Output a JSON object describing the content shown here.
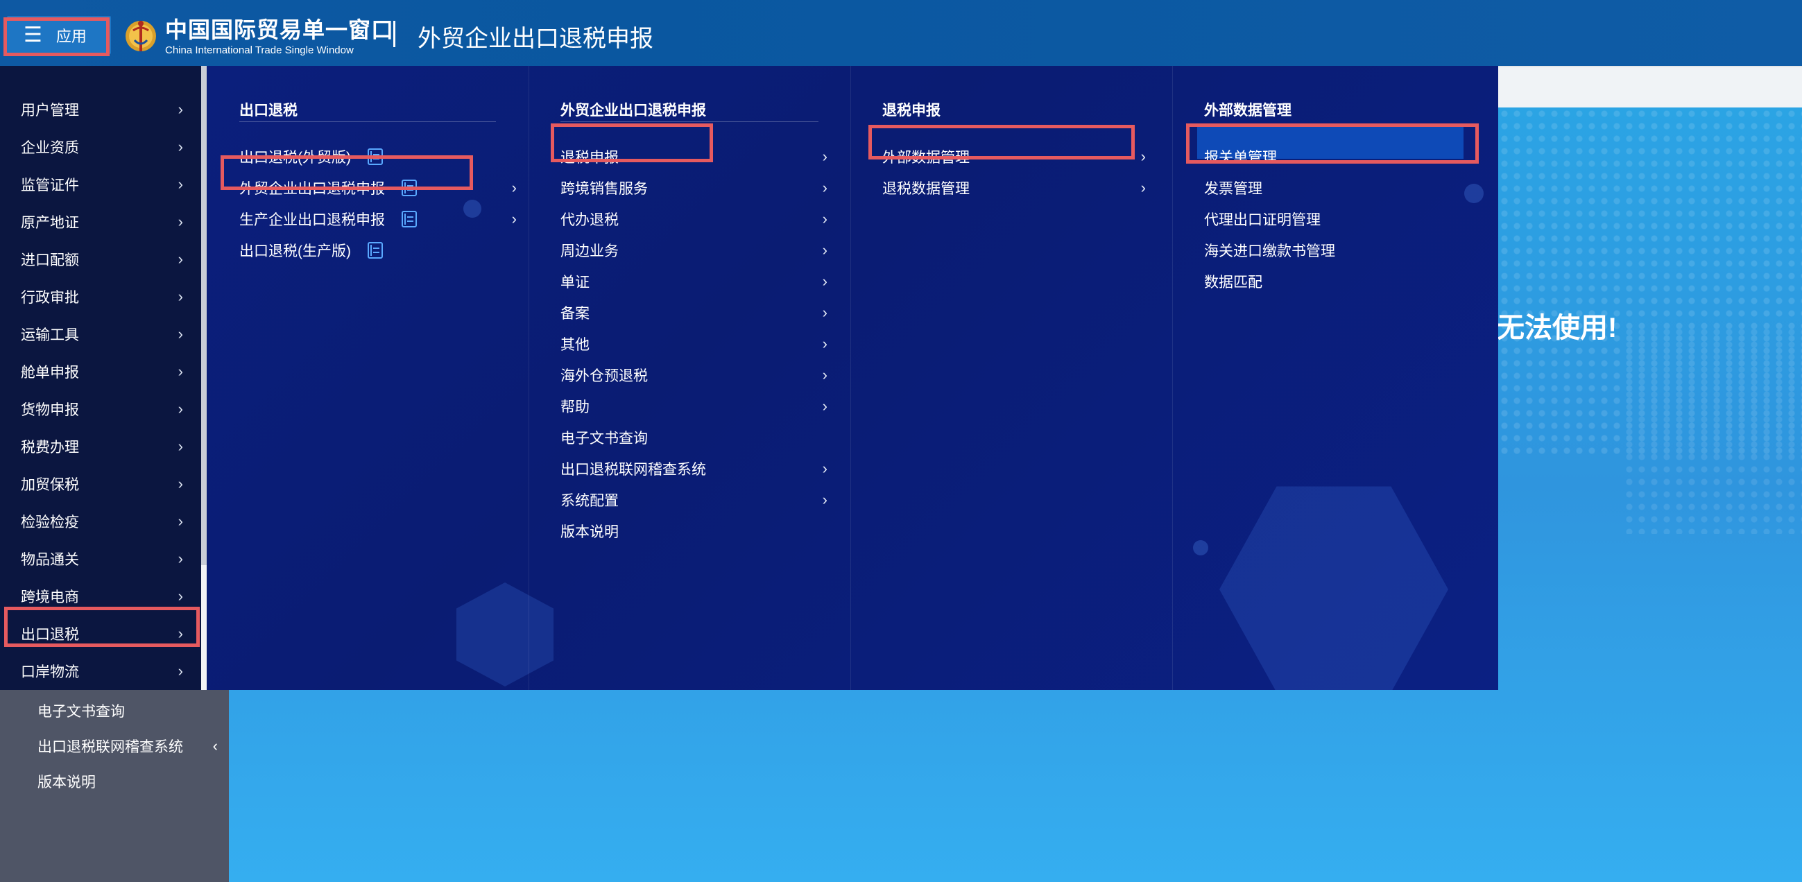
{
  "header": {
    "apps_label": "应用",
    "brand_title": "中国国际贸易单一窗口",
    "brand_subtitle": "China International Trade Single Window",
    "page_title": "外贸企业出口退税申报"
  },
  "notice": "无法使用!",
  "sidebar": {
    "items": [
      {
        "label": "用户管理"
      },
      {
        "label": "企业资质"
      },
      {
        "label": "监管证件"
      },
      {
        "label": "原产地证"
      },
      {
        "label": "进口配额"
      },
      {
        "label": "行政审批"
      },
      {
        "label": "运输工具"
      },
      {
        "label": "舱单申报"
      },
      {
        "label": "货物申报"
      },
      {
        "label": "税费办理"
      },
      {
        "label": "加贸保税"
      },
      {
        "label": "检验检疫"
      },
      {
        "label": "物品通关"
      },
      {
        "label": "跨境电商"
      },
      {
        "label": "出口退税"
      },
      {
        "label": "口岸物流"
      }
    ],
    "bottom_items": [
      {
        "label": "电子文书查询"
      },
      {
        "label": "出口退税联网稽查系统"
      },
      {
        "label": "版本说明"
      }
    ]
  },
  "mega_menu": {
    "col1": {
      "heading": "出口退税",
      "items": [
        {
          "label": "出口退税(外贸版)"
        },
        {
          "label": "外贸企业出口退税申报"
        },
        {
          "label": "生产企业出口退税申报"
        },
        {
          "label": "出口退税(生产版)"
        }
      ]
    },
    "col2": {
      "heading": "外贸企业出口退税申报",
      "items": [
        {
          "label": "退税申报"
        },
        {
          "label": "跨境销售服务"
        },
        {
          "label": "代办退税"
        },
        {
          "label": "周边业务"
        },
        {
          "label": "单证"
        },
        {
          "label": "备案"
        },
        {
          "label": "其他"
        },
        {
          "label": "海外仓预退税"
        },
        {
          "label": "帮助"
        },
        {
          "label": "电子文书查询"
        },
        {
          "label": "出口退税联网稽查系统"
        },
        {
          "label": "系统配置"
        },
        {
          "label": "版本说明"
        }
      ]
    },
    "col3": {
      "heading": "退税申报",
      "items": [
        {
          "label": "外部数据管理"
        },
        {
          "label": "退税数据管理"
        }
      ]
    },
    "col4": {
      "heading": "外部数据管理",
      "items": [
        {
          "label": "报关单管理"
        },
        {
          "label": "发票管理"
        },
        {
          "label": "代理出口证明管理"
        },
        {
          "label": "海关进口缴款书管理"
        },
        {
          "label": "数据匹配"
        }
      ]
    }
  },
  "colors": {
    "header_bg": "#0b58a2",
    "sidebar_bg": "#0b1640",
    "mega_bg": "#0b1f7c",
    "highlight_red": "#e65a5f",
    "doc_icon_blue": "#5aa9ff"
  },
  "icons": {
    "apps": "menu-icon",
    "chevron": "chevron-right-icon",
    "chevron_left": "chevron-left-icon",
    "doc": "document-icon"
  }
}
